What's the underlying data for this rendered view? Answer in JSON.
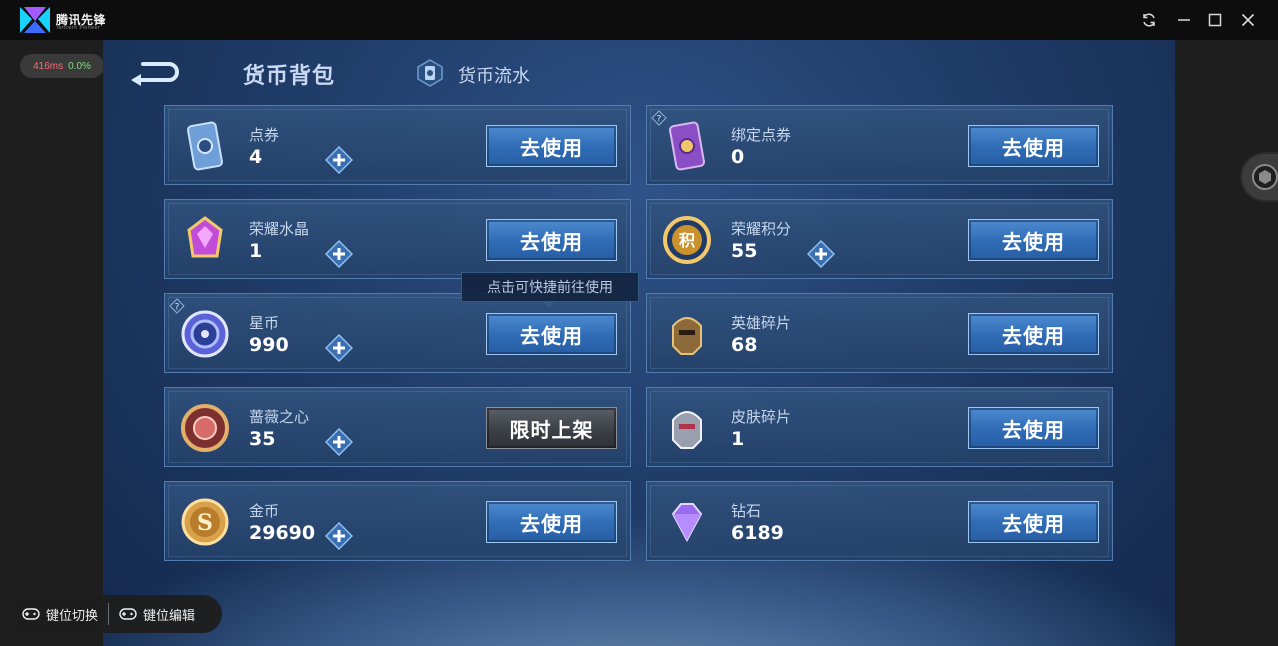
{
  "titlebar": {
    "app_name": "腾讯先锋",
    "app_sub": "Tencent Pioneer",
    "buttons": [
      "refresh-icon",
      "minimize-icon",
      "maximize-icon",
      "close-icon"
    ]
  },
  "perf": {
    "latency": "416ms",
    "loss": "0.0%"
  },
  "header": {
    "active_tab": "货币背包",
    "tab2": "货币流水"
  },
  "tooltip": "点击可快捷前往使用",
  "currencies": [
    {
      "name": "点券",
      "value": "4",
      "has_plus": true,
      "button": "去使用",
      "button_style": "blue",
      "icon": "voucher-icon",
      "has_help": false
    },
    {
      "name": "绑定点券",
      "value": "0",
      "has_plus": false,
      "button": "去使用",
      "button_style": "blue",
      "icon": "bound-voucher-icon",
      "has_help": true
    },
    {
      "name": "荣耀水晶",
      "value": "1",
      "has_plus": true,
      "button": "去使用",
      "button_style": "blue",
      "icon": "glory-crystal-icon",
      "has_help": false
    },
    {
      "name": "荣耀积分",
      "value": "55",
      "has_plus": true,
      "button": "去使用",
      "button_style": "blue",
      "icon": "glory-points-icon",
      "has_help": false
    },
    {
      "name": "星币",
      "value": "990",
      "has_plus": true,
      "button": "去使用",
      "button_style": "blue",
      "icon": "star-coin-icon",
      "has_help": true
    },
    {
      "name": "英雄碎片",
      "value": "68",
      "has_plus": false,
      "button": "去使用",
      "button_style": "blue",
      "icon": "hero-fragment-icon",
      "has_help": false
    },
    {
      "name": "蔷薇之心",
      "value": "35",
      "has_plus": true,
      "button": "限时上架",
      "button_style": "dark",
      "icon": "rose-heart-icon",
      "has_help": false
    },
    {
      "name": "皮肤碎片",
      "value": "1",
      "has_plus": false,
      "button": "去使用",
      "button_style": "blue",
      "icon": "skin-fragment-icon",
      "has_help": false
    },
    {
      "name": "金币",
      "value": "29690",
      "has_plus": true,
      "button": "去使用",
      "button_style": "blue",
      "icon": "gold-coin-icon",
      "has_help": false
    },
    {
      "name": "钻石",
      "value": "6189",
      "has_plus": false,
      "button": "去使用",
      "button_style": "blue",
      "icon": "diamond-icon",
      "has_help": false
    }
  ],
  "keybar": {
    "switch_label": "键位切换",
    "edit_label": "键位编辑"
  },
  "colors": {
    "accent_blue": "#2f6bb5",
    "bg_navy": "#1d3863",
    "frame": "#151515"
  }
}
